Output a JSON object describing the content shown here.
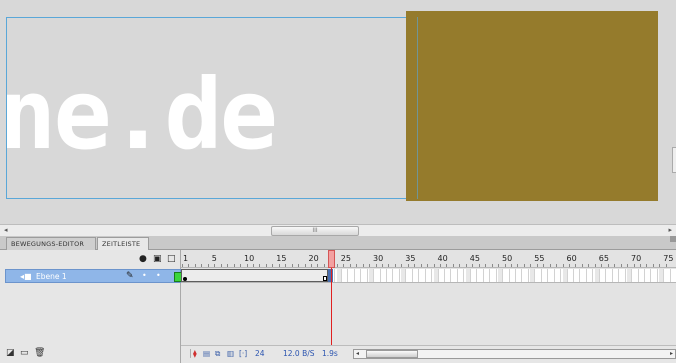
{
  "stage": {
    "text": "ne.de",
    "shape_color": "#957b2c",
    "scroll_thumb_glyph": "III"
  },
  "tabs": [
    {
      "label": "BEWEGUNGS-EDITOR"
    },
    {
      "label": "ZEITLEISTE"
    }
  ],
  "layers": [
    {
      "name": "Ebene 1",
      "outline_color": "#3bd63b"
    }
  ],
  "ruler": {
    "first": "1",
    "labels": [
      "5",
      "10",
      "15",
      "20",
      "25",
      "30",
      "35",
      "40",
      "45",
      "50",
      "55",
      "60",
      "65",
      "70",
      "75"
    ],
    "current_frame": 25
  },
  "status": {
    "frame": "24",
    "fps": "12.0 B/S",
    "time": "1.9s"
  },
  "icons": {
    "eye": "eye-icon",
    "lock": "lock-icon",
    "outline": "outline-icon",
    "pencil": "pencil-icon",
    "new_layer": "new-layer-icon",
    "new_folder": "new-folder-icon",
    "delete": "trash-icon"
  }
}
